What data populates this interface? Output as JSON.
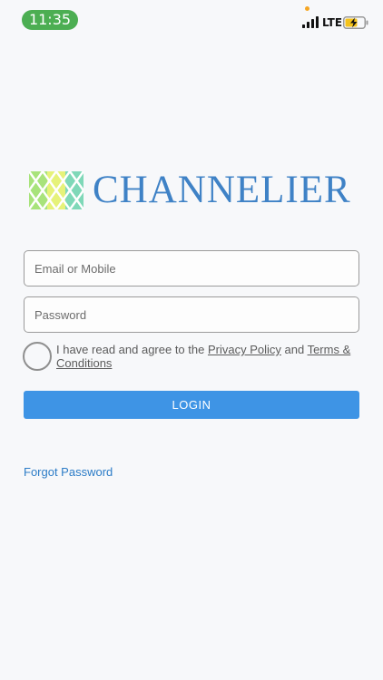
{
  "status_bar": {
    "time": "11:35",
    "network": "LTE",
    "time_pill_color": "#4cae52",
    "mic_dot_color": "#f5a623",
    "battery_color": "#f4c21b"
  },
  "brand": {
    "name": "CHANNELIER",
    "color": "#3f82c6",
    "mark_colors": [
      "#a8e37b",
      "#e6f27a",
      "#7fd8b8"
    ]
  },
  "form": {
    "email_placeholder": "Email or Mobile",
    "email_value": "",
    "password_placeholder": "Password",
    "password_value": "",
    "consent_prefix": "I have read and agree to the ",
    "privacy_link": "Privacy Policy",
    "consent_and": " and ",
    "terms_link": "Terms & Conditions",
    "consent_checked": false,
    "login_label": "LOGIN",
    "login_color": "#3e94e5"
  },
  "links": {
    "forgot_password": "Forgot Password"
  }
}
